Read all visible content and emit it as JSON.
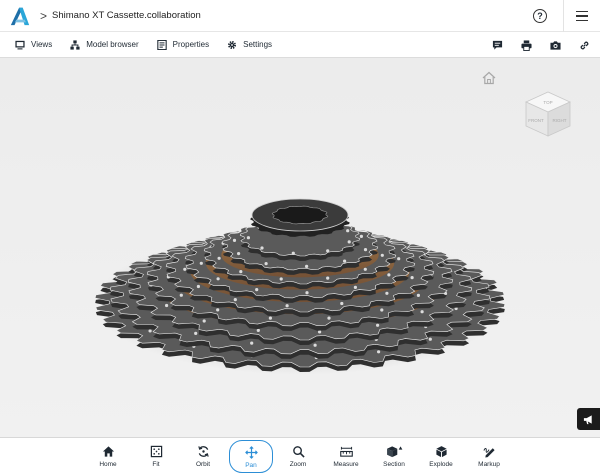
{
  "header": {
    "breadcrumb_separator": ">",
    "document_title": "Shimano XT Cassette.collaboration",
    "help_label": "?"
  },
  "toolbar": {
    "views": "Views",
    "model_browser": "Model browser",
    "properties": "Properties",
    "settings": "Settings"
  },
  "viewcube": {
    "top": "TOP",
    "front": "FRONT",
    "right": "RIGHT"
  },
  "bottom_bar": {
    "items": [
      {
        "label": "Home",
        "icon": "home-icon"
      },
      {
        "label": "Fit",
        "icon": "fit-icon"
      },
      {
        "label": "Orbit",
        "icon": "orbit-icon"
      },
      {
        "label": "Pan",
        "icon": "pan-icon",
        "active": true
      },
      {
        "label": "Zoom",
        "icon": "zoom-icon"
      },
      {
        "label": "Measure",
        "icon": "measure-icon"
      },
      {
        "label": "Section",
        "icon": "section-icon"
      },
      {
        "label": "Explode",
        "icon": "explode-icon"
      },
      {
        "label": "Markup",
        "icon": "markup-icon"
      }
    ]
  },
  "colors": {
    "accent": "#2c8ed6",
    "viewport_bg": "#eeeeee",
    "model_metal": "#5a5a5a",
    "model_copper": "#c8782a"
  }
}
